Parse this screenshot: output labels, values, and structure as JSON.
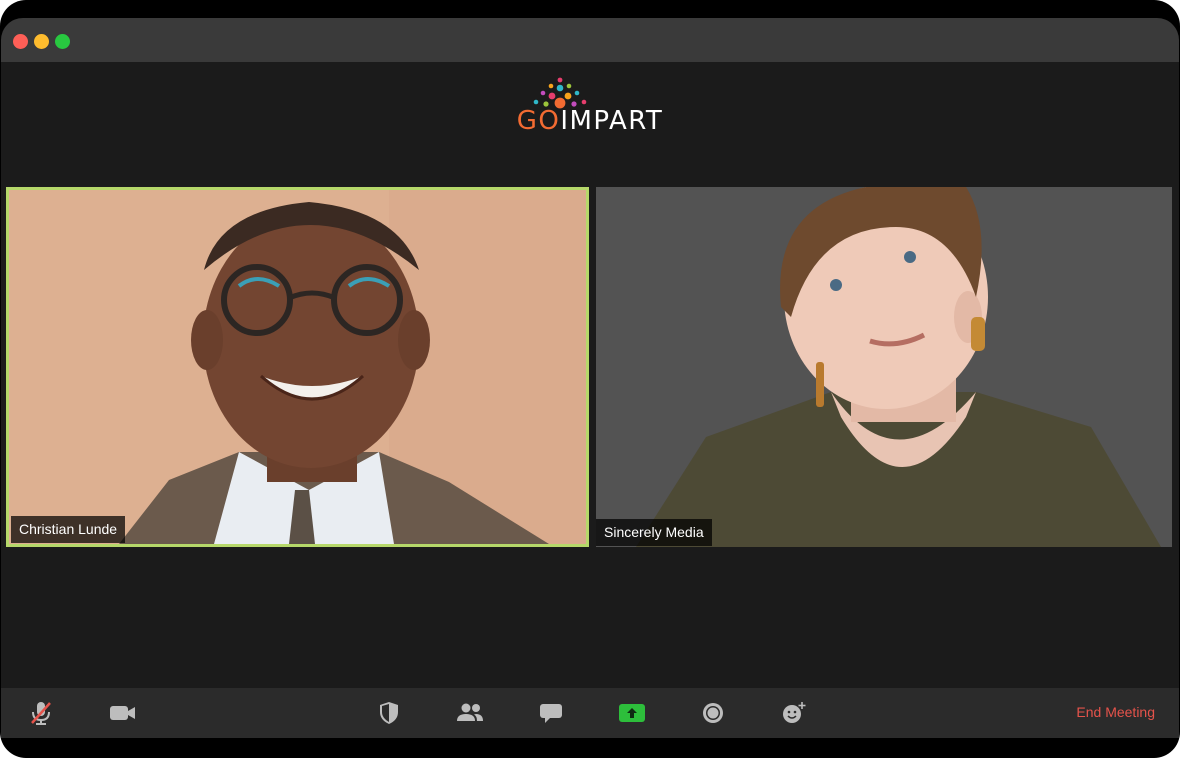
{
  "brand": {
    "logo_prefix": "GO",
    "logo_suffix": "IMPART",
    "prefix_color": "#f26b32"
  },
  "participants": [
    {
      "name": "Christian Lunde",
      "active_speaker": true,
      "highlight_color": "#b6d86a"
    },
    {
      "name": "Sincerely Media",
      "active_speaker": false
    }
  ],
  "toolbar": {
    "buttons": [
      {
        "icon": "microphone-muted-icon"
      },
      {
        "icon": "video-camera-icon"
      },
      {
        "icon": "shield-security-icon"
      },
      {
        "icon": "participants-icon"
      },
      {
        "icon": "chat-bubble-icon"
      },
      {
        "icon": "share-screen-icon",
        "accent": "#2dbe3b"
      },
      {
        "icon": "record-icon"
      },
      {
        "icon": "reactions-icon"
      }
    ],
    "end_meeting_label": "End Meeting",
    "end_meeting_color": "#e5534b"
  }
}
